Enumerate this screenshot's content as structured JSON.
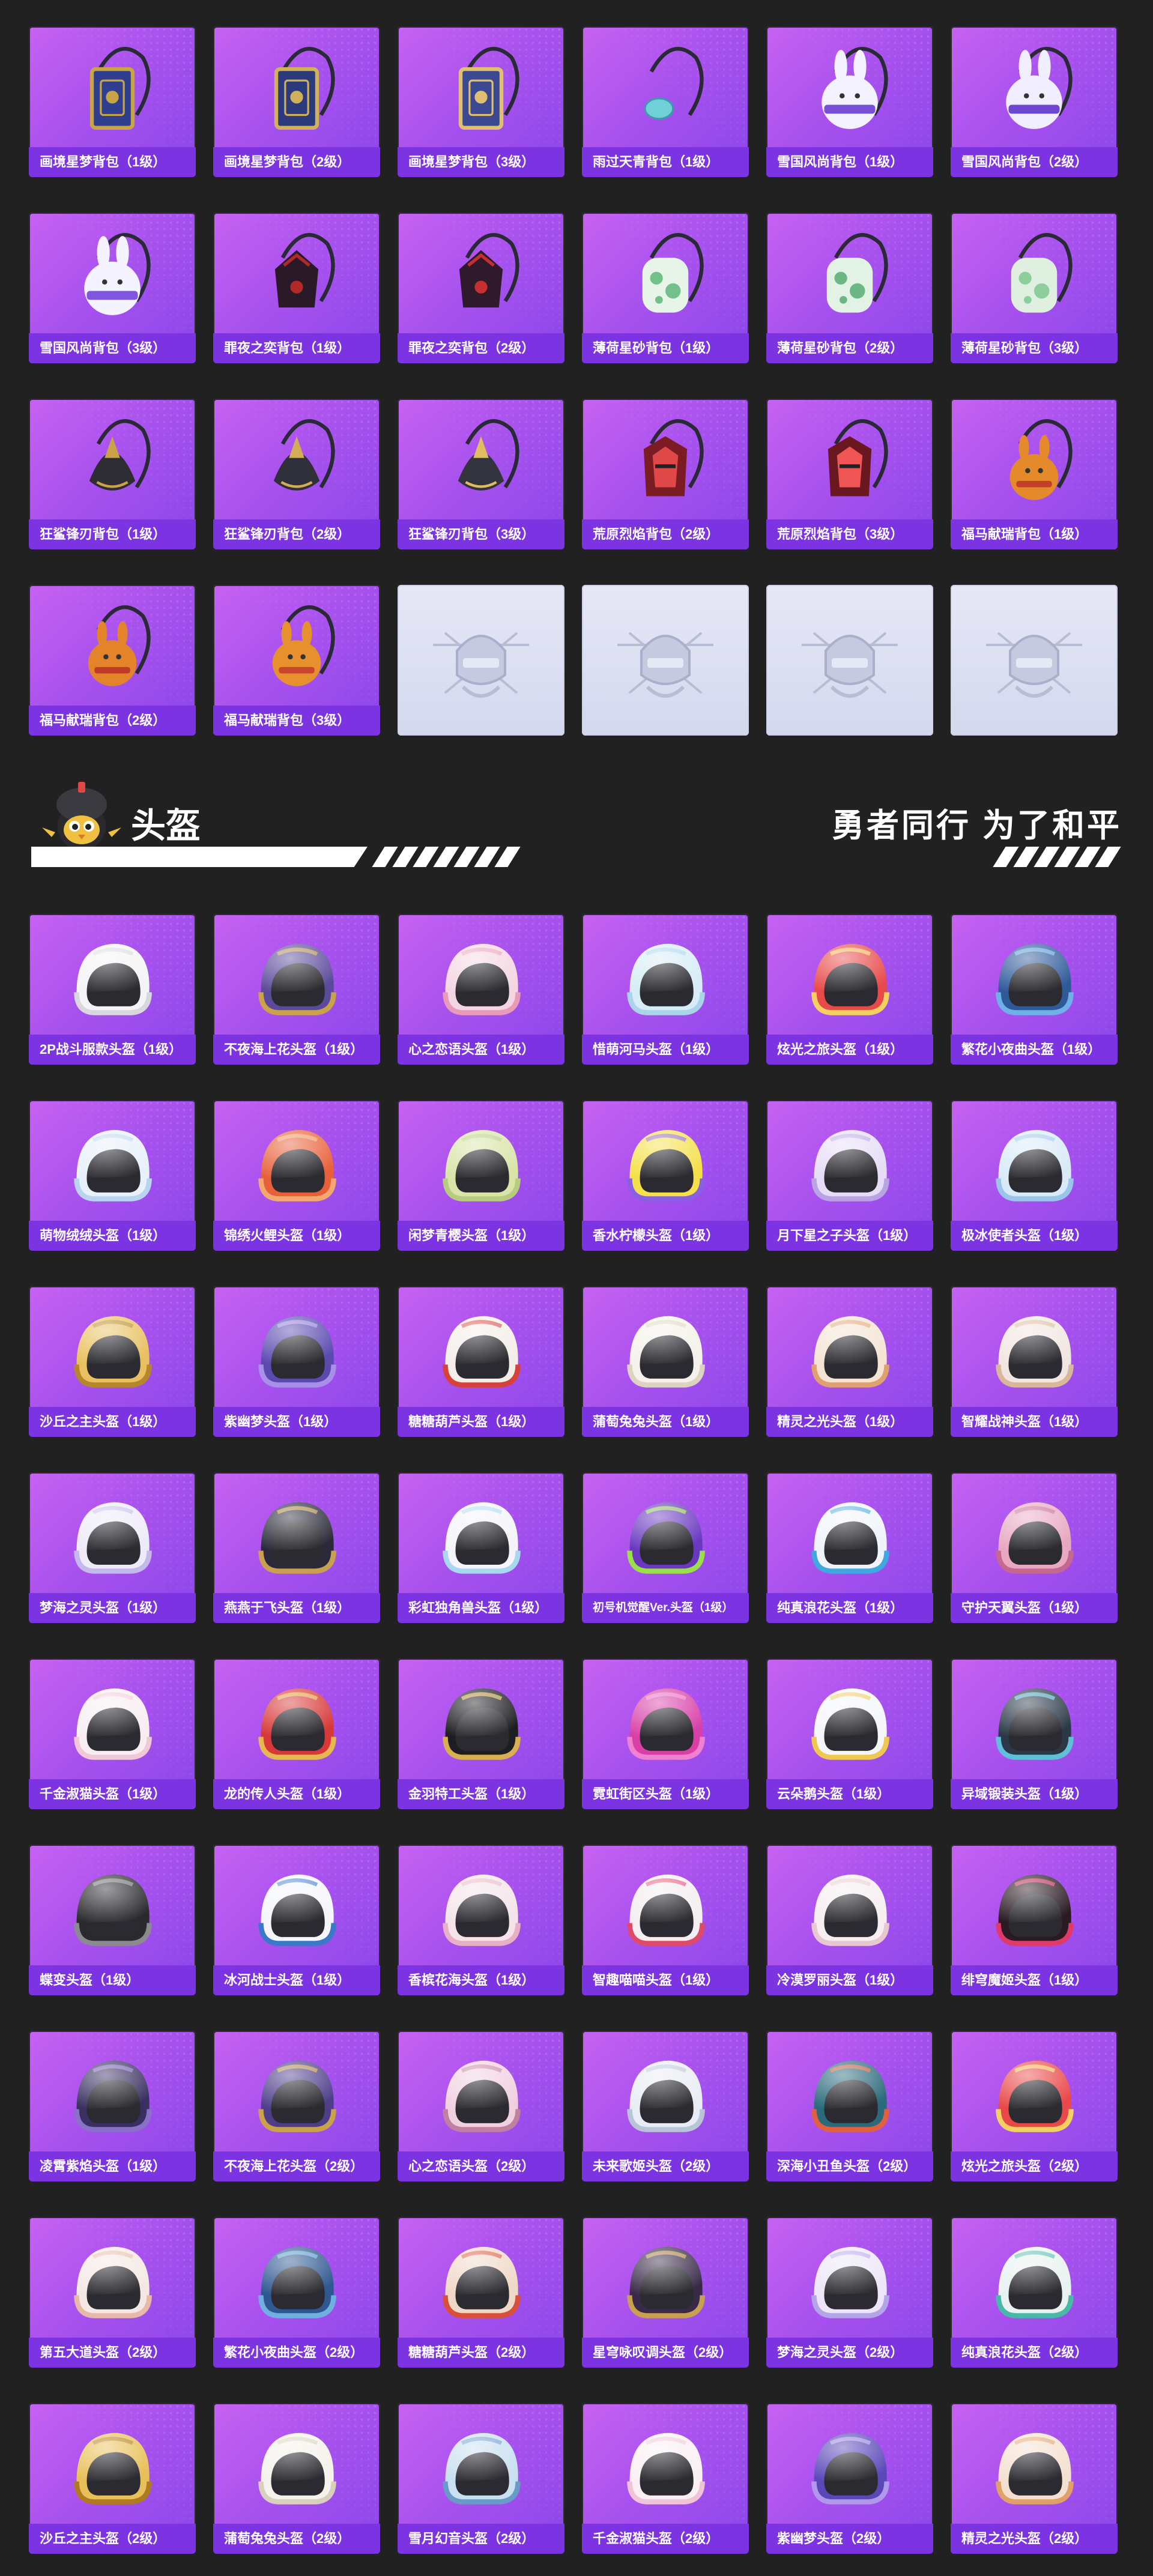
{
  "backpacks": [
    {
      "label": "画境星梦背包（1级）",
      "kind": "book",
      "c1": "#2f3e8f",
      "c2": "#c7a545"
    },
    {
      "label": "画境星梦背包（2级）",
      "kind": "book",
      "c1": "#2a3a7a",
      "c2": "#d1b05a"
    },
    {
      "label": "画境星梦背包（3级）",
      "kind": "book",
      "c1": "#3a4990",
      "c2": "#e0c070"
    },
    {
      "label": "雨过天青背包（1级）",
      "kind": "small",
      "c1": "#6fd0d8",
      "c2": "#3d9aa6"
    },
    {
      "label": "雪国风尚背包（1级）",
      "kind": "bunny",
      "c1": "#f4f2ff",
      "c2": "#7a4fd8"
    },
    {
      "label": "雪国风尚背包（2级）",
      "kind": "bunny",
      "c1": "#f0eeff",
      "c2": "#6d47d0"
    },
    {
      "label": "雪国风尚背包（3级）",
      "kind": "bunny",
      "c1": "#f5f3ff",
      "c2": "#8055e0"
    },
    {
      "label": "罪夜之奕背包（1级）",
      "kind": "dark",
      "c1": "#2a1a28",
      "c2": "#b02a2a"
    },
    {
      "label": "罪夜之奕背包（2级）",
      "kind": "dark",
      "c1": "#2e1a2a",
      "c2": "#c43030"
    },
    {
      "label": "薄荷星砂背包（1级）",
      "kind": "mint",
      "c1": "#e7f5e9",
      "c2": "#72c08a"
    },
    {
      "label": "薄荷星砂背包（2级）",
      "kind": "mint",
      "c1": "#e2f2e4",
      "c2": "#6bb884"
    },
    {
      "label": "薄荷星砂背包（3级）",
      "kind": "mint",
      "c1": "#dff0e0",
      "c2": "#8ccf9c"
    },
    {
      "label": "狂鲨锋刃背包（1级）",
      "kind": "shark",
      "c1": "#2d2d33",
      "c2": "#c9a24a"
    },
    {
      "label": "狂鲨锋刃背包（2级）",
      "kind": "shark",
      "c1": "#30303a",
      "c2": "#d3ad55"
    },
    {
      "label": "狂鲨锋刃背包（3级）",
      "kind": "shark",
      "c1": "#34343e",
      "c2": "#e0bd60"
    },
    {
      "label": "荒原烈焰背包（2级）",
      "kind": "fire",
      "c1": "#7a1c22",
      "c2": "#e04848"
    },
    {
      "label": "荒原烈焰背包（3级）",
      "kind": "fire",
      "c1": "#6a1820",
      "c2": "#ef5555"
    },
    {
      "label": "福马献瑞背包（1级）",
      "kind": "horse",
      "c1": "#e48a2a",
      "c2": "#c2402a"
    },
    {
      "label": "福马献瑞背包（2级）",
      "kind": "horse",
      "c1": "#e3842a",
      "c2": "#bd3b28"
    },
    {
      "label": "福马献瑞背包（3级）",
      "kind": "horse",
      "c1": "#e6902e",
      "c2": "#c94530"
    },
    {
      "label": "",
      "kind": "placeholder"
    },
    {
      "label": "",
      "kind": "placeholder"
    },
    {
      "label": "",
      "kind": "placeholder"
    },
    {
      "label": "",
      "kind": "placeholder"
    }
  ],
  "section": {
    "title": "头盔",
    "slogan": "勇者同行 为了和平"
  },
  "helmets": [
    {
      "label": "2P战斗服款头盔（1级）",
      "c1": "#f4f4f6",
      "c2": "#d8d8de"
    },
    {
      "label": "不夜海上花头盔（1级）",
      "c1": "#5b4a9a",
      "c2": "#c9a24a"
    },
    {
      "label": "心之恋语头盔（1级）",
      "c1": "#f4d6e2",
      "c2": "#e89ab8"
    },
    {
      "label": "惜萌河马头盔（1级）",
      "c1": "#d6ecf6",
      "c2": "#a9d4ea"
    },
    {
      "label": "炫光之旅头盔（1级）",
      "c1": "#e84a4a",
      "c2": "#f4d060"
    },
    {
      "label": "繁花小夜曲头盔（1级）",
      "c1": "#2f5a9a",
      "c2": "#6fb0e8"
    },
    {
      "label": "萌物绒绒头盔（1级）",
      "c1": "#e8f0fa",
      "c2": "#b8d4f0"
    },
    {
      "label": "锦绣火鲤头盔（1级）",
      "c1": "#e8603a",
      "c2": "#f4a870"
    },
    {
      "label": "闲梦青樱头盔（1级）",
      "c1": "#d8e4a8",
      "c2": "#b8cc80"
    },
    {
      "label": "香水柠檬头盔（1级）",
      "c1": "#f4e04a",
      "c2": "#8a60e0"
    },
    {
      "label": "月下星之子头盔（1级）",
      "c1": "#e6dcf6",
      "c2": "#b8a4e4"
    },
    {
      "label": "极冰使者头盔（1级）",
      "c1": "#d8eaf8",
      "c2": "#9ac4ea"
    },
    {
      "label": "沙丘之主头盔（1级）",
      "c1": "#e8c060",
      "c2": "#b8862a"
    },
    {
      "label": "紫幽梦头盔（1级）",
      "c1": "#5a4ab0",
      "c2": "#a890e8"
    },
    {
      "label": "糖糖葫芦头盔（1级）",
      "c1": "#f4eee8",
      "c2": "#d8403a"
    },
    {
      "label": "蒲萄兔兔头盔（1级）",
      "c1": "#f4f2ea",
      "c2": "#dcd4c0"
    },
    {
      "label": "精灵之光头盔（1级）",
      "c1": "#f4e4d4",
      "c2": "#e0a070"
    },
    {
      "label": "智耀战神头盔（1级）",
      "c1": "#f0e6e0",
      "c2": "#d8b898"
    },
    {
      "label": "梦海之灵头盔（1级）",
      "c1": "#eeeaf8",
      "c2": "#c4b8ec"
    },
    {
      "label": "燕燕于飞头盔（1级）",
      "c1": "#2a2a3a",
      "c2": "#c8a050"
    },
    {
      "label": "彩虹独角兽头盔（1级）",
      "c1": "#f4f4fa",
      "c2": "#a8d8f0"
    },
    {
      "label": "初号机觉醒Ver.头盔（1级）",
      "c1": "#6a38c0",
      "c2": "#9ae04a"
    },
    {
      "label": "纯真浪花头盔（1级）",
      "c1": "#f0f4fa",
      "c2": "#40a8e0"
    },
    {
      "label": "守护天翼头盔（1级）",
      "c1": "#e8a8c0",
      "c2": "#c46890"
    },
    {
      "label": "千金淑猫头盔（1级）",
      "c1": "#f8eef2",
      "c2": "#f0c8d8"
    },
    {
      "label": "龙的传人头盔（1级）",
      "c1": "#d83838",
      "c2": "#e8b850"
    },
    {
      "label": "金羽特工头盔（1级）",
      "c1": "#1e1e22",
      "c2": "#d8b050"
    },
    {
      "label": "霓虹街区头盔（1级）",
      "c1": "#d840a8",
      "c2": "#f080d0"
    },
    {
      "label": "云朵鹅头盔（1级）",
      "c1": "#f4f6fa",
      "c2": "#f0c850"
    },
    {
      "label": "异域锻装头盔（1级）",
      "c1": "#2a3848",
      "c2": "#60c0d8"
    },
    {
      "label": "蝶变头盔（1级）",
      "c1": "#2a2a2e",
      "c2": "#8a8a90"
    },
    {
      "label": "冰河战士头盔（1级）",
      "c1": "#f4f6fa",
      "c2": "#3a78c8"
    },
    {
      "label": "香槟花海头盔（1级）",
      "c1": "#f4e4ea",
      "c2": "#e8b0c4"
    },
    {
      "label": "智趣喵喵头盔（1级）",
      "c1": "#f4eef0",
      "c2": "#e04a6a"
    },
    {
      "label": "冷漠罗丽头盔（1级）",
      "c1": "#f6eef0",
      "c2": "#e8c8d0"
    },
    {
      "label": "绯穹魔姬头盔（1级）",
      "c1": "#2a1a22",
      "c2": "#e03a6a"
    },
    {
      "label": "凌霄紫焰头盔（1级）",
      "c1": "#3a3060",
      "c2": "#8a70c8"
    },
    {
      "label": "不夜海上花头盔（2级）",
      "c1": "#4e3e8a",
      "c2": "#c9a24a"
    },
    {
      "label": "心之恋语头盔（2级）",
      "c1": "#f0d0e0",
      "c2": "#c080a0"
    },
    {
      "label": "未来歌姬头盔（2级）",
      "c1": "#e8ecf4",
      "c2": "#b8c4d8"
    },
    {
      "label": "深海小丑鱼头盔（2级）",
      "c1": "#2a6a7a",
      "c2": "#e06040"
    },
    {
      "label": "炫光之旅头盔（2级）",
      "c1": "#e84848",
      "c2": "#f4d060"
    },
    {
      "label": "第五大道头盔（2级）",
      "c1": "#f4e8e4",
      "c2": "#e8b8a8"
    },
    {
      "label": "繁花小夜曲头盔（2级）",
      "c1": "#2e5890",
      "c2": "#70b0e0"
    },
    {
      "label": "糖糖葫芦头盔（2级）",
      "c1": "#f0d8c8",
      "c2": "#d8503a"
    },
    {
      "label": "星穹咏叹调头盔（2级）",
      "c1": "#3a2a4a",
      "c2": "#c8a050"
    },
    {
      "label": "梦海之灵头盔（2级）",
      "c1": "#ece6f8",
      "c2": "#b4a4e8"
    },
    {
      "label": "纯真浪花头盔（2级）",
      "c1": "#e8f2f0",
      "c2": "#48b8a8"
    },
    {
      "label": "沙丘之主头盔（2级）",
      "c1": "#e8c058",
      "c2": "#b07a20"
    },
    {
      "label": "蒲萄兔兔头盔（2级）",
      "c1": "#f4f2ea",
      "c2": "#d8d0bc"
    },
    {
      "label": "雪月幻音头盔（2级）",
      "c1": "#c8e0f0",
      "c2": "#6a9ac8"
    },
    {
      "label": "千金淑猫头盔（2级）",
      "c1": "#faf0f4",
      "c2": "#f0c4d6"
    },
    {
      "label": "紫幽梦头盔（2级）",
      "c1": "#5a48b8",
      "c2": "#b098ec"
    },
    {
      "label": "精灵之光头盔（2级）",
      "c1": "#f4e0d0",
      "c2": "#e0a068"
    }
  ]
}
